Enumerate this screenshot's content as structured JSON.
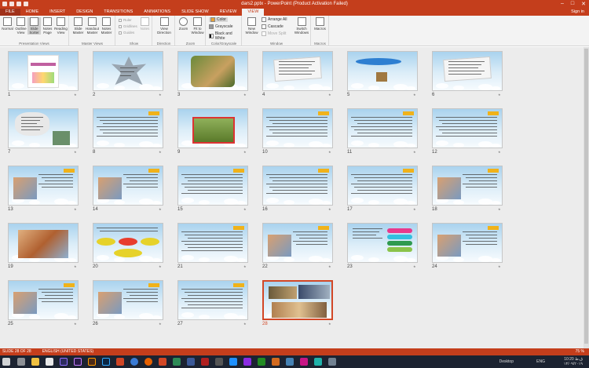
{
  "titlebar": {
    "title": "dars2.pptx - PowerPoint (Product Activation Failed)",
    "window_controls": [
      "–",
      "□",
      "✕"
    ]
  },
  "tabs": [
    "FILE",
    "HOME",
    "INSERT",
    "DESIGN",
    "TRANSITIONS",
    "ANIMATIONS",
    "SLIDE SHOW",
    "REVIEW",
    "VIEW"
  ],
  "active_tab": "VIEW",
  "signin": "Sign in",
  "ribbon": {
    "presentation_views": {
      "label": "Presentation Views",
      "buttons": [
        "Normal",
        "Outline View",
        "Slide Sorter",
        "Notes Page",
        "Reading View"
      ],
      "selected": "Slide Sorter"
    },
    "master_views": {
      "label": "Master Views",
      "buttons": [
        "Slide Master",
        "Handout Master",
        "Notes Master"
      ]
    },
    "show": {
      "label": "Show",
      "items": [
        "Ruler",
        "Gridlines",
        "Guides"
      ],
      "notes": "Notes"
    },
    "direction": {
      "label": "Direction",
      "button": "View Direction"
    },
    "zoom": {
      "label": "Zoom",
      "buttons": [
        "Zoom",
        "Fit to Window"
      ]
    },
    "color": {
      "label": "Color/Grayscale",
      "options": [
        "Color",
        "Grayscale",
        "Black and White"
      ],
      "selected": "Color"
    },
    "window": {
      "label": "Window",
      "buttons": [
        "New Window"
      ],
      "small": [
        "Arrange All",
        "Cascade",
        "Move Split"
      ]
    },
    "switch": {
      "button": "Switch Windows"
    },
    "macros": {
      "label": "Macros",
      "button": "Macros"
    }
  },
  "slides": [
    {
      "n": "1",
      "kind": "title"
    },
    {
      "n": "2",
      "kind": "star"
    },
    {
      "n": "3",
      "kind": "picture"
    },
    {
      "n": "4",
      "kind": "textcard"
    },
    {
      "n": "5",
      "kind": "oval"
    },
    {
      "n": "6",
      "kind": "textcard"
    },
    {
      "n": "7",
      "kind": "cloudtext"
    },
    {
      "n": "8",
      "kind": "text"
    },
    {
      "n": "9",
      "kind": "grass"
    },
    {
      "n": "10",
      "kind": "text"
    },
    {
      "n": "11",
      "kind": "text"
    },
    {
      "n": "12",
      "kind": "text"
    },
    {
      "n": "13",
      "kind": "textpic"
    },
    {
      "n": "14",
      "kind": "textpic"
    },
    {
      "n": "15",
      "kind": "text"
    },
    {
      "n": "16",
      "kind": "text"
    },
    {
      "n": "17",
      "kind": "text"
    },
    {
      "n": "18",
      "kind": "textpic"
    },
    {
      "n": "19",
      "kind": "picture2"
    },
    {
      "n": "20",
      "kind": "ovals"
    },
    {
      "n": "21",
      "kind": "text"
    },
    {
      "n": "22",
      "kind": "textpic"
    },
    {
      "n": "23",
      "kind": "pills"
    },
    {
      "n": "24",
      "kind": "textpic"
    },
    {
      "n": "25",
      "kind": "textpic"
    },
    {
      "n": "26",
      "kind": "textpic"
    },
    {
      "n": "27",
      "kind": "text"
    },
    {
      "n": "28",
      "kind": "collage"
    }
  ],
  "selected_slide": "28",
  "statusbar": {
    "slide_info": "SLIDE 28 OF 28",
    "language": "ENGLISH (UNITED STATES)",
    "zoom": "75 %"
  },
  "taskbar": {
    "desktop": "Desktop",
    "lang": "ENG",
    "time": "10:20 ق.ظ",
    "date": "۱۴/۰۹/۲۰۱۹"
  },
  "colors": {
    "accent": "#c43e1c",
    "selected_border": "#d24726"
  }
}
